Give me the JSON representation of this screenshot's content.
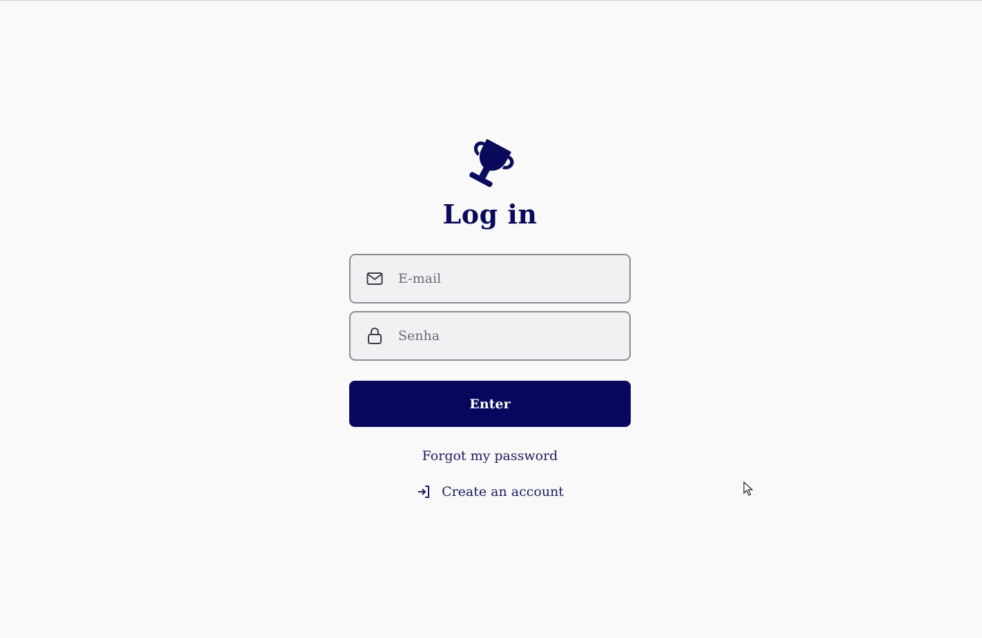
{
  "app": {
    "title": "Log in",
    "logo_icon": "trophy-icon"
  },
  "form": {
    "email": {
      "icon": "mail-icon",
      "placeholder": "E-mail",
      "value": ""
    },
    "password": {
      "icon": "lock-icon",
      "placeholder": "Senha",
      "value": ""
    },
    "submit_label": "Enter"
  },
  "links": {
    "forgot_password": "Forgot my password",
    "create_account": "Create an account",
    "create_account_icon": "login-arrow-icon"
  },
  "colors": {
    "primary": "#07075e",
    "title": "#0a0a5c",
    "field_bg": "#f1f1f3",
    "field_border": "#8b8b96",
    "page_bg": "#f9f9fa"
  }
}
